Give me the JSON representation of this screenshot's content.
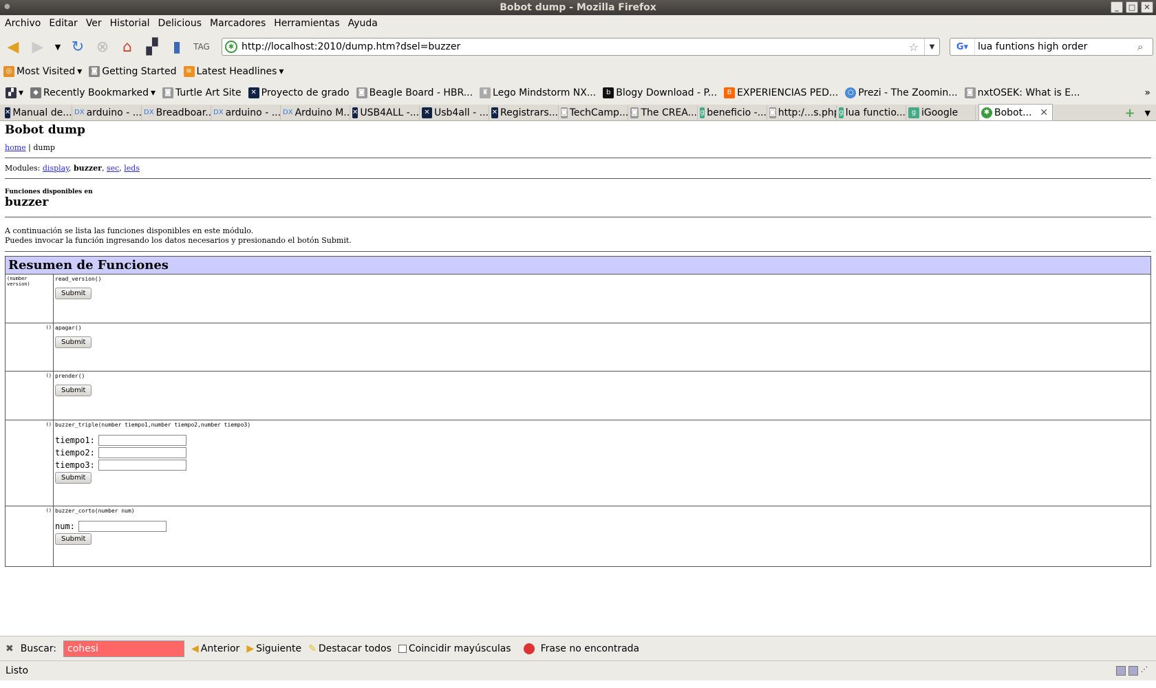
{
  "window": {
    "title": "Bobot dump - Mozilla Firefox"
  },
  "menu": [
    "Archivo",
    "Editar",
    "Ver",
    "Historial",
    "Delicious",
    "Marcadores",
    "Herramientas",
    "Ayuda"
  ],
  "url": "http://localhost:2010/dump.htm?dsel=buzzer",
  "search": {
    "query": "lua funtions high order"
  },
  "bookmarks_row1": [
    "Most Visited",
    "Getting Started",
    "Latest Headlines"
  ],
  "bookmarks_row2": [
    "Recently Bookmarked",
    "Turtle Art Site",
    "Proyecto de grado",
    "Beagle Board - HBR...",
    "Lego Mindstorm NX...",
    "Blogy Download - P...",
    "EXPERIENCIAS PED...",
    "Prezi - The Zoomin...",
    "nxtOSEK: What is E..."
  ],
  "tabs": [
    "Manual de...",
    "arduino - ...",
    "Breadboar...",
    "arduino - ...",
    "Arduino M...",
    "USB4ALL -...",
    "Usb4all - ...",
    "Registrars...",
    "TechCamp...",
    "The CREA...",
    "beneficio -...",
    "http:/...s.php",
    "lua functio...",
    "iGoogle"
  ],
  "active_tab": "Bobot...",
  "page": {
    "title": "Bobot dump",
    "crumb_home": "home",
    "crumb_sep": "| dump",
    "modules_label": "Modules:",
    "modules": {
      "m1": "display",
      "m2": "buzzer",
      "m3": "sec",
      "m4": "leds"
    },
    "subhead": "Funciones disponibles en",
    "module_name": "buzzer",
    "intro1": "A continuación se lista las funciones disponibles en este módulo.",
    "intro2": "Puedes invocar la función ingresando los datos necesarios y presionando el botón Submit.",
    "table_title": "Resumen de Funciones",
    "submit": "Submit",
    "functions": [
      {
        "ret": "(number version)",
        "sig": "read_version()"
      },
      {
        "ret": "()",
        "sig": "apagar()"
      },
      {
        "ret": "()",
        "sig": "prender()"
      },
      {
        "ret": "()",
        "sig": "buzzer_triple(number tiempo1,number tiempo2,number tiempo3)",
        "fields": [
          "tiempo1:",
          "tiempo2:",
          "tiempo3:"
        ]
      },
      {
        "ret": "()",
        "sig": "buzzer_corto(number num)",
        "fields": [
          "num:"
        ]
      }
    ]
  },
  "findbar": {
    "label": "Buscar:",
    "value": "cohesi",
    "prev": "Anterior",
    "next": "Siguiente",
    "highlight": "Destacar todos",
    "match_case": "Coincidir mayúsculas",
    "status": "Frase no encontrada"
  },
  "status": "Listo"
}
